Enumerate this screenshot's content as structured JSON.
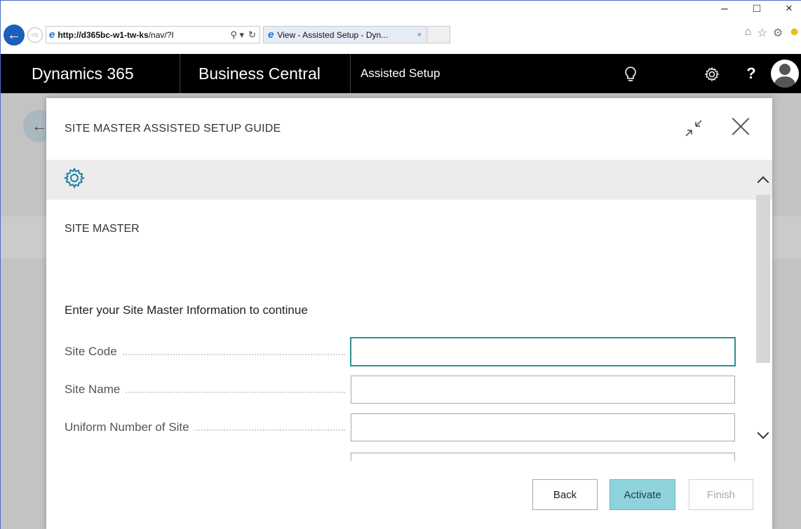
{
  "browser": {
    "url_host": "http://d365bc-w1-tw-ks",
    "url_path": "/nav/?I",
    "tab_title": "View - Assisted Setup - Dyn...",
    "search_glyph": "⚲ ▾",
    "refresh_glyph": "↻",
    "tab_close": "×",
    "window_min": "–",
    "window_max": "□",
    "window_close": "×"
  },
  "appbar": {
    "brand": "Dynamics 365",
    "product": "Business Central",
    "area": "Assisted Setup",
    "help": "?"
  },
  "dialog": {
    "title": "SITE MASTER ASSISTED SETUP GUIDE",
    "step_title": "SITE MASTER",
    "intro": "Enter your Site Master Information to continue",
    "fields": [
      {
        "label": "Site Code",
        "value": ""
      },
      {
        "label": "Site Name",
        "value": ""
      },
      {
        "label": "Uniform Number of Site",
        "value": ""
      }
    ],
    "buttons": {
      "back": "Back",
      "activate": "Activate",
      "finish": "Finish"
    }
  },
  "colors": {
    "accent_teal": "#2c8f8f",
    "activate_bg": "#8fd3dc",
    "appbar_bg": "#000000"
  },
  "icons": [
    "back-arrow-icon",
    "forward-arrow-icon",
    "ie-logo-icon",
    "search-icon",
    "refresh-icon",
    "home-icon",
    "favorites-star-icon",
    "settings-gear-icon",
    "smiley-icon",
    "lightbulb-icon",
    "gear-icon",
    "help-icon",
    "user-avatar-icon",
    "collapse-icon",
    "close-icon",
    "setup-gear-icon",
    "scroll-up-icon",
    "scroll-down-icon"
  ]
}
